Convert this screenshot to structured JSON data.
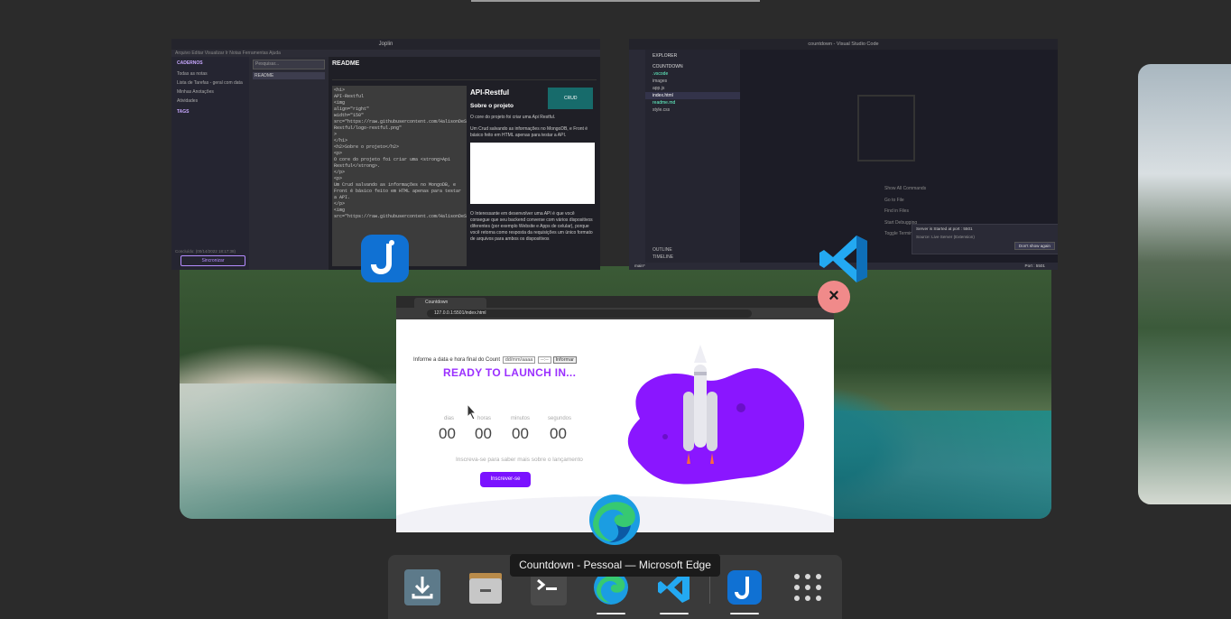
{
  "joplin": {
    "window_title": "Joplin",
    "menu": "Arquivo  Editar  Visualizar  Ir  Notas  Ferramentas  Ajuda",
    "sidebar": {
      "header_notebooks": "CADERNOS",
      "items": [
        "Todas as notas",
        "Lista de Tarefas - geral com data",
        "Minhas Anotações",
        "Atividades"
      ],
      "header_tags": "TAGS",
      "footer": "Concluído: (00/14/2022 18:17:38)",
      "sync_button": "Sincronizar"
    },
    "notelist": {
      "search_placeholder": "Pesquisar...",
      "note": "README"
    },
    "editor": {
      "note_title": "README",
      "markdown_lines": [
        "<h1>",
        "  API-Restful",
        "  <img",
        "    align=\"right\"",
        "    width=\"150\"",
        "src=\"https://raw.githubusercontent.com/HalisonDeSouza/assets/master/API-Restful/logo-restful.png\"",
        "  >",
        "</h1>",
        "",
        "<h2>Sobre o projeto</h2>",
        "",
        "<p>",
        "O core do projeto foi criar uma <strong>Api Restful</strong>.",
        "</p>",
        "<p>",
        "Um Crud salvando as informações no MongoDB, e Front é básico feito em HTML apenas para testar a API.",
        "</p>",
        "<img",
        "src=\"https://raw.githubusercontent.com/HalisonDeSouza/assets/master/API-"
      ],
      "preview_title": "API-Restful",
      "preview_h2": "Sobre o projeto",
      "preview_p1": "O core do projeto foi criar uma Api Restful.",
      "preview_p2": "Um Crud salvando as informações no MongoDB, e Front é básico feito em HTML apenas para testar a API.",
      "preview_p3": "O Interessante em desenvolver uma API é que você consegue que seu backend converse com vários dispositivos diferentes (por exemplo Website e Apps de celular), porque você retorna como resposta da requisições um único formato de arquivos para ambos os dispositivos",
      "preview_badge": "CRUD"
    }
  },
  "vscode": {
    "window_title": "countdown - Visual Studio Code",
    "explorer_title": "EXPLORER",
    "section_title": "COUNTDOWN",
    "files": [
      ".vscode",
      "images",
      "app.js",
      "index.html",
      "readme.md",
      "style.css"
    ],
    "shortcuts": [
      "Show All Commands",
      "Go to File",
      "Find in Files",
      "Start Debugging",
      "Toggle Terminal"
    ],
    "outline": "OUTLINE",
    "timeline": "TIMELINE",
    "toast_message": "Server is Started at port : 5501",
    "toast_source": "Source: Live Server (Extension)",
    "toast_button": "Don't show again",
    "status_branch": "main*",
    "status_port": "Port : 5501"
  },
  "edge": {
    "tab_title": "Countdown",
    "url": "127.0.0.1:5501/index.html",
    "page": {
      "prompt": "Informe a data e hora final do Count",
      "date_placeholder": "dd/mm/aaaa",
      "time_placeholder": "--:--",
      "inform_button": "Informar",
      "title": "READY TO LAUNCH IN...",
      "labels": [
        "dias",
        "horas",
        "minutos",
        "segundos"
      ],
      "values": [
        "00",
        "00",
        "00",
        "00"
      ],
      "subtitle": "Inscreva-se para saber mais sobre o lançamento",
      "subscribe_button": "Inscrever-se"
    }
  },
  "overview": {
    "close_symbol": "×",
    "tooltip": "Countdown - Pessoal — Microsoft Edge"
  },
  "colors": {
    "accent_purple": "#9b30ff",
    "joplin_blue": "#1071d3",
    "vscode_blue": "#23a9f2",
    "close_red": "#f08a8a"
  },
  "dock": {
    "items": [
      "downloads-icon",
      "files-icon",
      "terminal-icon",
      "edge-icon",
      "vscode-icon",
      "joplin-icon",
      "app-grid-icon"
    ],
    "running": [
      "edge-icon",
      "vscode-icon",
      "joplin-icon"
    ]
  }
}
